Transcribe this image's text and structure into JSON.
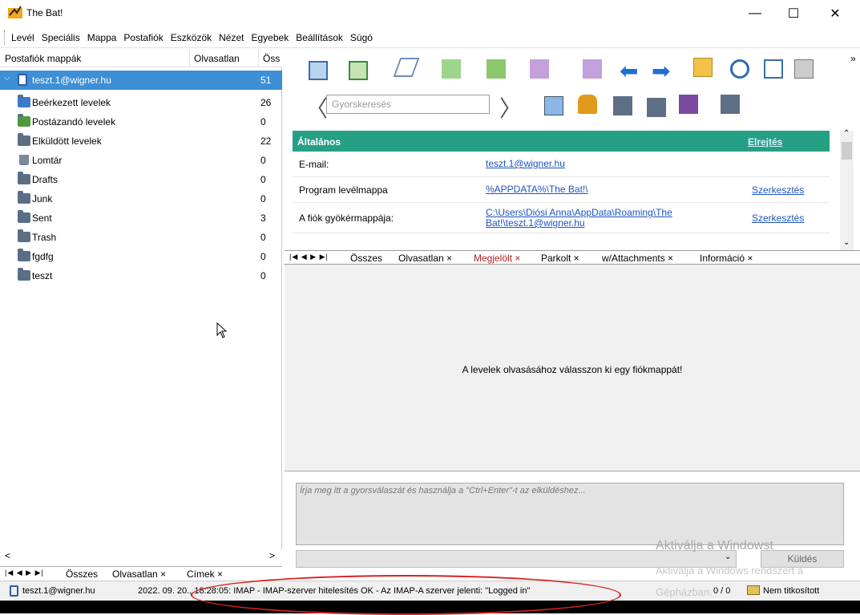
{
  "window": {
    "title": "The Bat!",
    "minimize": "—",
    "maximize": "☐",
    "close": "✕"
  },
  "menu": [
    "Levél",
    "Speciális",
    "Mappa",
    "Postafiók",
    "Eszközök",
    "Nézet",
    "Egyebek",
    "Beállítások",
    "Súgó"
  ],
  "left_header": {
    "folders": "Postafiók mappák",
    "unread": "Olvasatlan",
    "total": "Öss"
  },
  "account": {
    "name": "teszt.1@wigner.hu",
    "count": "51"
  },
  "folders": [
    {
      "name": "Beérkezett levelek",
      "count": "26",
      "icon": "inbox-icon"
    },
    {
      "name": "Postázandó levelek",
      "count": "0",
      "icon": "outbox-icon"
    },
    {
      "name": "Elküldött levelek",
      "count": "22",
      "icon": "sent-icon"
    },
    {
      "name": "Lomtár",
      "count": "0",
      "icon": "trash-icon"
    },
    {
      "name": "Drafts",
      "count": "0",
      "icon": "folder-icon"
    },
    {
      "name": "Junk",
      "count": "0",
      "icon": "folder-icon"
    },
    {
      "name": "Sent",
      "count": "3",
      "icon": "folder-icon"
    },
    {
      "name": "Trash",
      "count": "0",
      "icon": "folder-icon"
    },
    {
      "name": "fgdfg",
      "count": "0",
      "icon": "folder-icon"
    },
    {
      "name": "teszt",
      "count": "0",
      "icon": "folder-icon"
    }
  ],
  "left_tabs": [
    "Összes",
    "Olvasatlan ×",
    "Címek ×"
  ],
  "quicksearch": {
    "placeholder": "Gyorskeresés"
  },
  "info": {
    "header": "Általános",
    "hide": "Elrejtés",
    "rows": [
      {
        "label": "E-mail:",
        "value": "teszt.1@wigner.hu",
        "edit": ""
      },
      {
        "label": "Program levélmappa",
        "value": "%APPDATA%\\The Bat!\\",
        "edit": "Szerkesztés"
      },
      {
        "label": "A fiók gyökérmappája:",
        "value": "C:\\Users\\Diósi Anna\\AppData\\Roaming\\The Bat!\\teszt.1@wigner.hu",
        "edit": "Szerkesztés"
      }
    ]
  },
  "right_tabs": [
    "Összes",
    "Olvasatlan ×",
    "Megjelölt ×",
    "Parkolt ×",
    "w/Attachments ×",
    "Információ ×"
  ],
  "message_area": "A levelek olvasásához válasszon ki egy fiókmappát!",
  "reply": {
    "placeholder": "Írja meg itt a gyorsválaszát és használja a \"Ctrl+Enter\"-t az elküldéshez...",
    "send": "Küldés"
  },
  "watermark": {
    "line1": "Aktiválja a Windowst",
    "line2": "Aktiválja a Windows rendszert a",
    "line3": "Gépházban."
  },
  "status": {
    "account": "teszt.1@wigner.hu",
    "log": "2022. 09. 20., 18:28:05: IMAP  - IMAP-szerver hitelesítés OK - Az IMAP-A szerver jelenti: \"Logged in\"",
    "counter": "0 / 0",
    "encryption": "Nem titkosított"
  },
  "colors": {
    "accent_green": "#26a085",
    "selection": "#3d8fd6",
    "link": "#1c55c0",
    "annotation": "#d8221f"
  }
}
